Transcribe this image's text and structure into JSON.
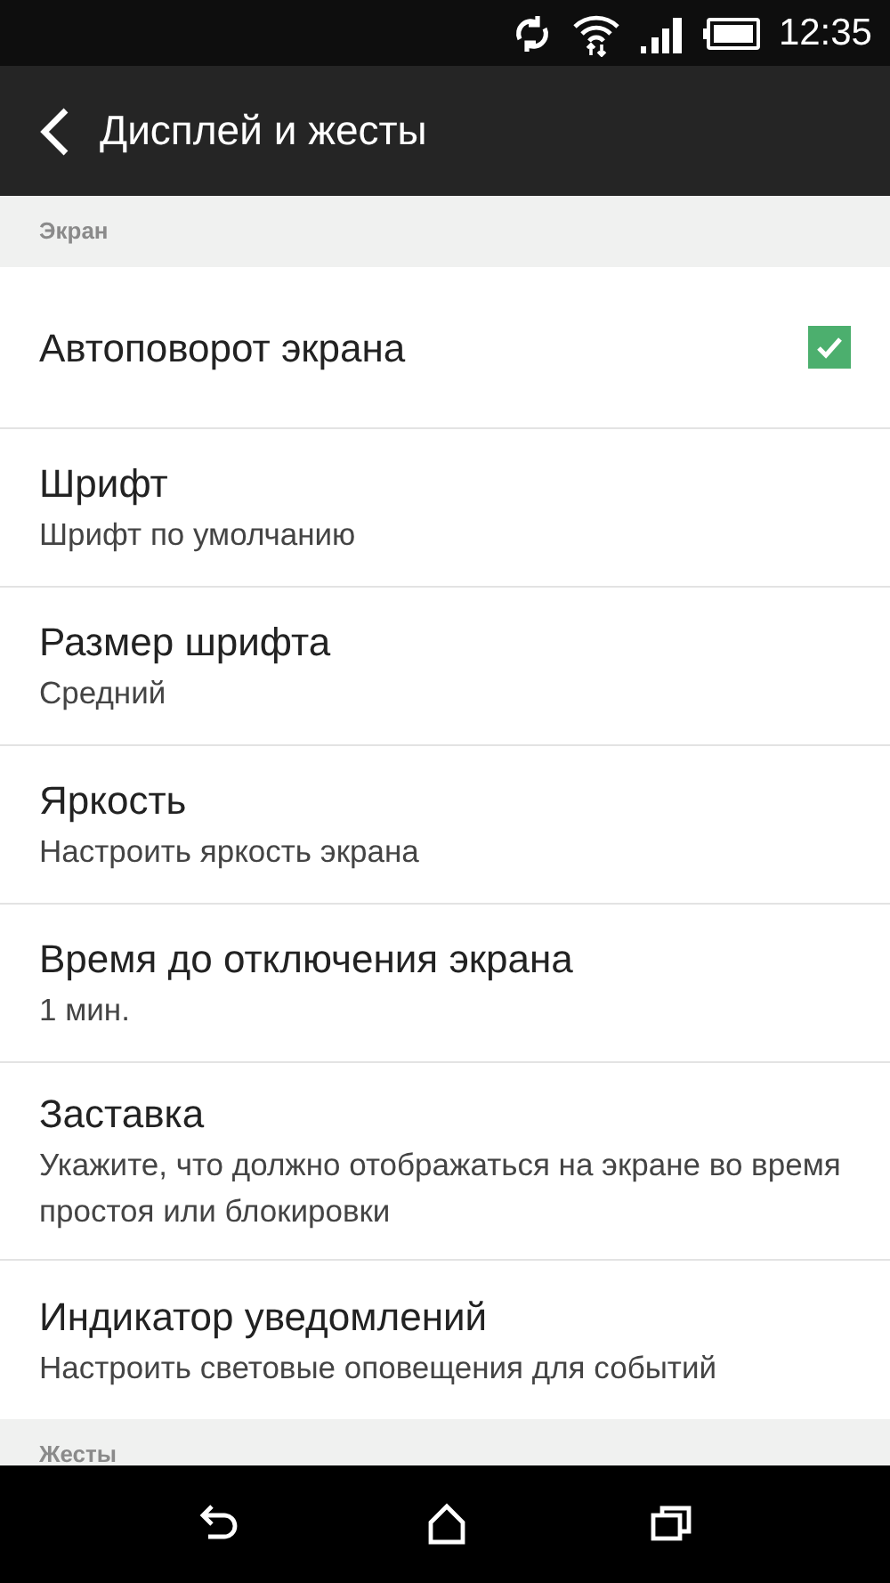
{
  "status_bar": {
    "time": "12:35"
  },
  "header": {
    "title": "Дисплей и жесты"
  },
  "sections": [
    {
      "title": "Экран",
      "items": [
        {
          "kind": "checkbox",
          "title": "Автоповорот экрана",
          "checked": true
        },
        {
          "kind": "text",
          "title": "Шрифт",
          "subtitle": "Шрифт по умолчанию"
        },
        {
          "kind": "text",
          "title": "Размер шрифта",
          "subtitle": "Средний"
        },
        {
          "kind": "text",
          "title": "Яркость",
          "subtitle": "Настроить яркость экрана"
        },
        {
          "kind": "text",
          "title": "Время до отключения экрана",
          "subtitle": "1 мин."
        },
        {
          "kind": "text",
          "title": "Заставка",
          "subtitle": "Укажите, что должно отображаться на экране во время простоя или блокировки"
        },
        {
          "kind": "text",
          "title": "Индикатор уведомлений",
          "subtitle": "Настроить световые оповещения для событий"
        }
      ]
    },
    {
      "title": "Жесты"
    }
  ]
}
